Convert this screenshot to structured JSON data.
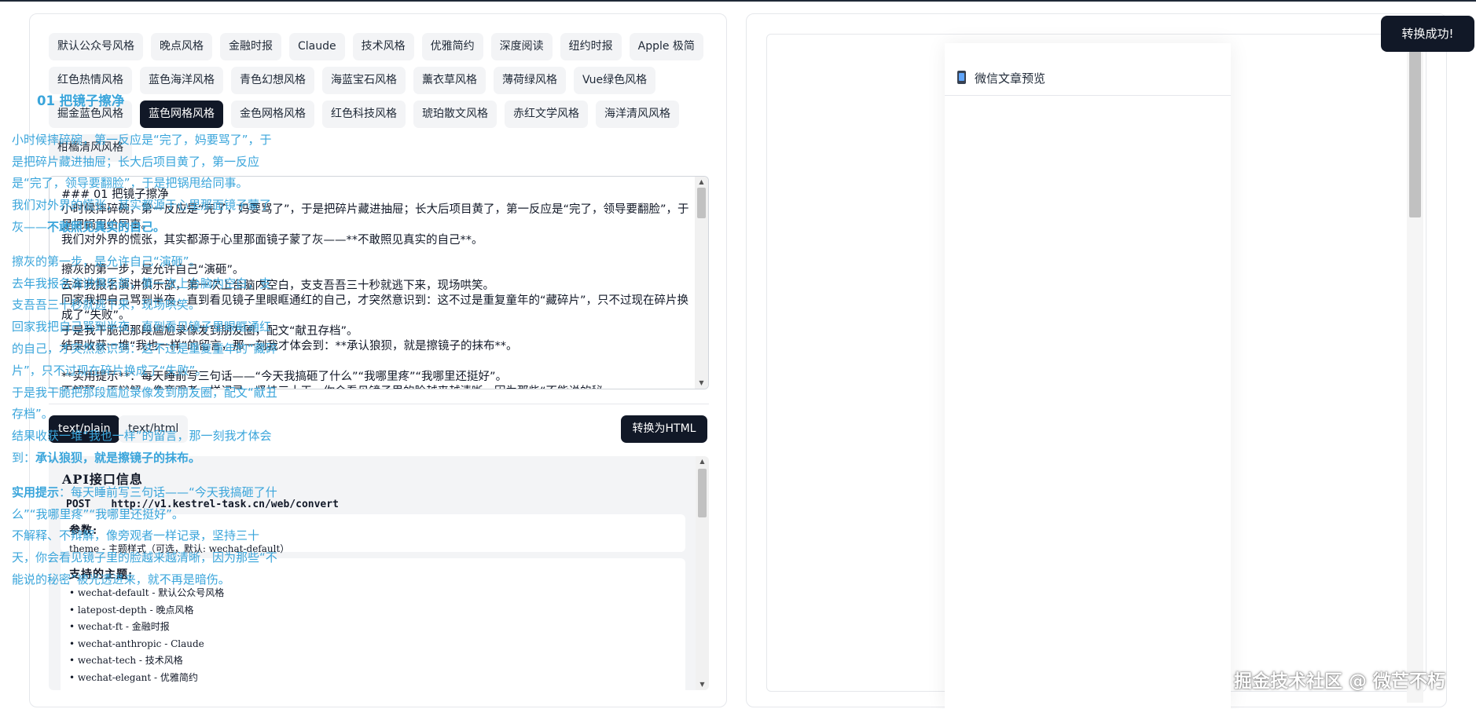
{
  "themes": [
    {
      "label": "默认公众号风格",
      "active": false
    },
    {
      "label": "晚点风格",
      "active": false
    },
    {
      "label": "金融时报",
      "active": false
    },
    {
      "label": "Claude",
      "active": false
    },
    {
      "label": "技术风格",
      "active": false
    },
    {
      "label": "优雅简约",
      "active": false
    },
    {
      "label": "深度阅读",
      "active": false
    },
    {
      "label": "纽约时报",
      "active": false
    },
    {
      "label": "Apple 极简",
      "active": false
    },
    {
      "label": "红色热情风格",
      "active": false
    },
    {
      "label": "蓝色海洋风格",
      "active": false
    },
    {
      "label": "青色幻想风格",
      "active": false
    },
    {
      "label": "海蓝宝石风格",
      "active": false
    },
    {
      "label": "薰衣草风格",
      "active": false
    },
    {
      "label": "薄荷绿风格",
      "active": false
    },
    {
      "label": "Vue绿色风格",
      "active": false
    },
    {
      "label": "掘金蓝色风格",
      "active": false
    },
    {
      "label": "蓝色网格风格",
      "active": true
    },
    {
      "label": "金色网格风格",
      "active": false
    },
    {
      "label": "红色科技风格",
      "active": false
    },
    {
      "label": "琥珀散文风格",
      "active": false
    },
    {
      "label": "赤红文学风格",
      "active": false
    },
    {
      "label": "海洋清风风格",
      "active": false
    },
    {
      "label": "柑橘清风风格",
      "active": false
    }
  ],
  "editor": {
    "value": "### 01 把镜子擦净\n小时候摔碎碗，第一反应是“完了，妈要骂了”，于是把碎片藏进抽屉；长大后项目黄了，第一反应是“完了，领导要翻脸”，于是把锅甩给同事。\n我们对外界的慌张，其实都源于心里那面镜子蒙了灰——**不敢照见真实的自己**。\n\n擦灰的第一步，是允许自己“演砸”。\n去年我报名演讲俱乐部，第一次上台脑内空白，支支吾吾三十秒就逃下来，现场哄笑。\n回家我把自己骂到半夜，直到看见镜子里眼眶通红的自己，才突然意识到：这不过是重复童年的“藏碎片”，只不过现在碎片换成了“失败”。\n于是我干脆把那段尴尬录像发到朋友圈，配文“献丑存档”。\n结果收获一堆“我也一样”的留言，那一刻我才体会到：**承认狼狈，就是擦镜子的抹布**。\n\n**实用提示**：每天睡前写三句话——“今天我搞砸了什么”“我哪里疼”“我哪里还挺好”。\n不解释、不辩解，像旁观者一样记录，坚持三十天，你会看见镜子里的脸越来越清晰，因为那些“不能说的秘"
  },
  "modes": {
    "plain": "text/plain",
    "html": "text/html"
  },
  "convert_button": "转换为HTML",
  "api": {
    "title": "API接口信息",
    "method": "POST",
    "url": "http://v1.kestrel-task.cn/web/convert",
    "params_title": "参数:",
    "params": [
      "theme - 主题样式（可选，默认: wechat-default）"
    ],
    "themes_title": "支持的主题:",
    "theme_list": [
      "• wechat-default - 默认公众号风格",
      "• latepost-depth - 晚点风格",
      "• wechat-ft - 金融时报",
      "• wechat-anthropic - Claude",
      "• wechat-tech - 技术风格",
      "• wechat-elegant - 优雅简约"
    ]
  },
  "preview": {
    "header": "微信文章预览",
    "heading": "01 把镜子擦净",
    "text_color": "#3aa5db",
    "paragraphs": [
      [
        {
          "t": "小时候摔碎碗，第一反应是“完了，妈要骂了”，于是把碎片藏进抽屉；长大后项目黄了，第一反应是“完了，领导要翻脸”，于是把锅甩给同事。"
        },
        {
          "br": true
        },
        {
          "t": "我们对外界的慌张，其实都源于心里那面镜子蒙了灰——"
        },
        {
          "t": "不敢照见真实的自己。",
          "b": true
        }
      ],
      [
        {
          "t": "擦灰的第一步，是允许自己“演砸”。"
        },
        {
          "br": true
        },
        {
          "t": "去年我报名演讲俱乐部，第一次上台脑内空白，支支吾吾三十秒就逃下来，现场哄笑。"
        },
        {
          "br": true
        },
        {
          "t": "回家我把自己骂到半夜，直到看见镜子里眼眶通红的自己，才突然意识到：这不过是重复童年的“藏碎片”，只不过现在碎片换成了“失败”。"
        },
        {
          "br": true
        },
        {
          "t": "于是我干脆把那段尴尬录像发到朋友圈，配文“献丑存档”。"
        },
        {
          "br": true
        },
        {
          "t": "结果收获一堆“我也一样”的留言，那一刻我才体会到："
        },
        {
          "t": "承认狼狈，就是擦镜子的抹布。",
          "b": true
        }
      ],
      [
        {
          "t": "实用提示",
          "b": true
        },
        {
          "t": "：每天睡前写三句话——“今天我搞砸了什么”“我哪里疼”“我哪里还挺好”。"
        },
        {
          "br": true
        },
        {
          "t": "不解释、不辩解，像旁观者一样记录，坚持三十天，你会看见镜子里的脸越来越清晰，因为那些“不能说的秘密”被光透进来，就不再是暗伤。"
        }
      ]
    ]
  },
  "toast": "转换成功!",
  "watermark": "掘金技术社区 @ 微芒不朽"
}
